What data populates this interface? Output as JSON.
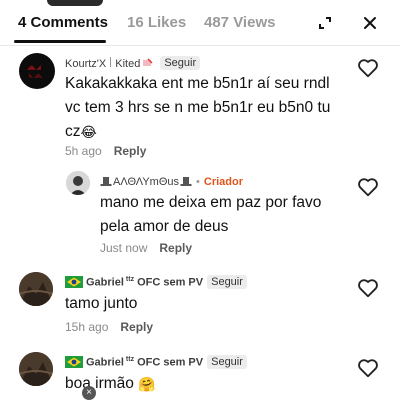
{
  "tabs": [
    {
      "label": "4 Comments",
      "active": true
    },
    {
      "label": "16 Likes",
      "active": false
    },
    {
      "label": "487 Views",
      "active": false
    }
  ],
  "header_icons": [
    "expand-icon",
    "close-icon"
  ],
  "comments": [
    {
      "author": "Kourtz'X | Kited",
      "author_parts": [
        "Kourtz'X",
        "Kited"
      ],
      "follow_label": "Seguir",
      "text_lines": [
        "Kakakakkaka ent me b5n1r aí seu rndl",
        "vc tem 3 hrs se n me b5n1r eu b5n0 tu",
        "cz"
      ],
      "text": "Kakakakkaka ent me b5n1r aí seu rndl vc tem 3 hrs se n me b5n1r eu b5n0 tu cz😂",
      "emoji": "😂",
      "time": "5h ago",
      "reply_label": "Reply"
    },
    {
      "author": "𝔸Λ𝕃𝔼ΛΥm𝔼us",
      "author_display": "ΑΛΘΛΥmΘus",
      "creator_label": "Criador",
      "text_lines": [
        "mano me deixa em paz por favo",
        "pela amor de deus"
      ],
      "text": "mano me deixa em paz por favo pela amor de deus",
      "time": "Just now",
      "reply_label": "Reply"
    },
    {
      "author_prefix": "Gabriel",
      "author_sup": "ttz",
      "author_suffix": "OFC sem PV",
      "follow_label": "Seguir",
      "text": "tamo junto",
      "time": "15h ago",
      "reply_label": "Reply"
    },
    {
      "author_prefix": "Gabriel",
      "author_sup": "ttz",
      "author_suffix": "OFC sem PV",
      "follow_label": "Seguir",
      "text": "boa irmão",
      "emoji": "🤗"
    }
  ],
  "colors": {
    "creator": "#e0551b",
    "tab_inactive": "#9a9a9a",
    "text": "#111111"
  }
}
